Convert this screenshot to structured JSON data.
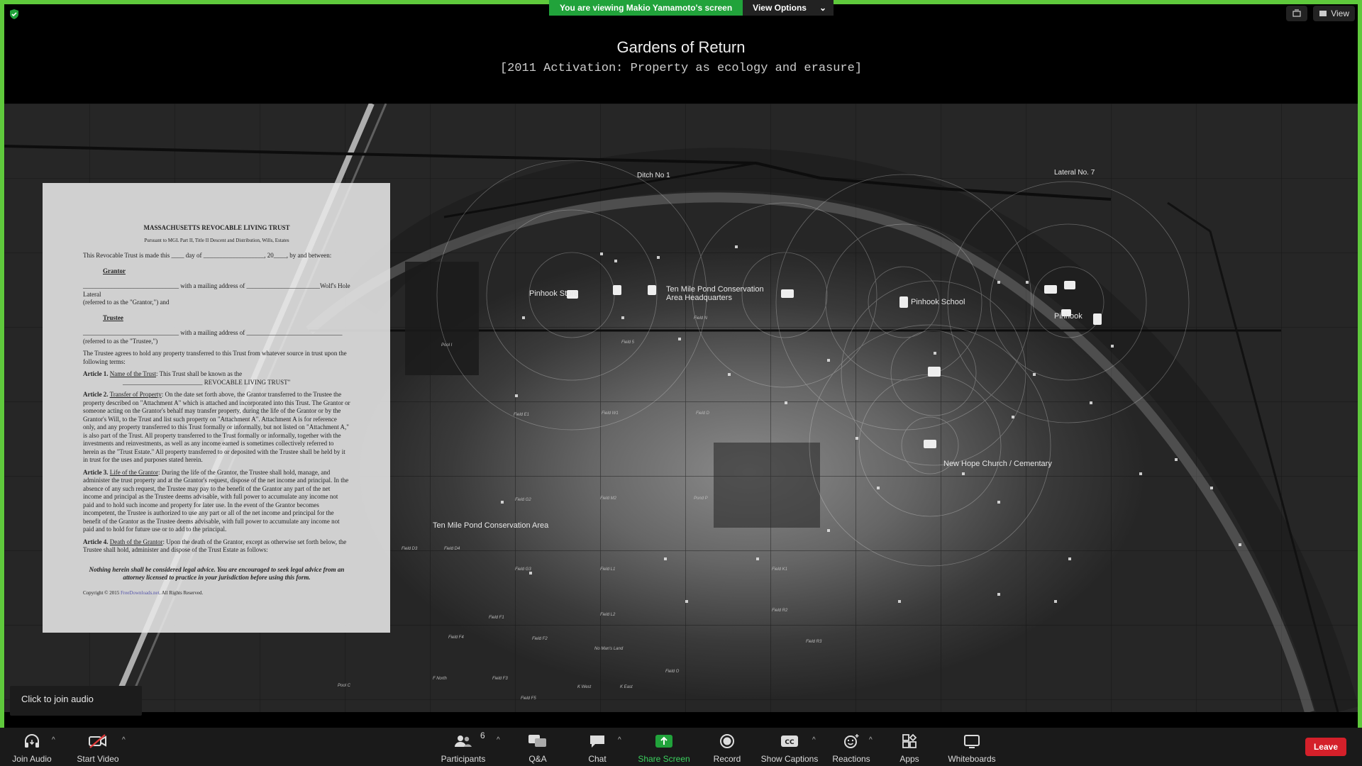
{
  "window": {
    "banner_text": "You are viewing Makio Yamamoto's screen",
    "view_options": "View Options",
    "view_button": "View"
  },
  "slide": {
    "title": "Gardens of Return",
    "subtitle": "[2011 Activation: Property as ecology and erasure]"
  },
  "map_labels": {
    "ditch": "Ditch No 1",
    "lateral": "Lateral No. 7",
    "pinhook_store": "Pinhook Store",
    "hq_line1": "Ten Mile Pond Conservation",
    "hq_line2": "Area Headquarters",
    "pinhook_school": "Pinhook School",
    "pinhook": "Pinhook",
    "church": "New Hope Church / Cementary",
    "conservation_area": "Ten Mile Pond Conservation Area"
  },
  "map_field_labels": [
    "Pool I",
    "Field 5",
    "Field N",
    "Field E1",
    "Field W1",
    "Field D",
    "Field G2",
    "Field M2",
    "Pond P",
    "Field D3",
    "Field D4",
    "Field G3",
    "Field L1",
    "Field K1",
    "Field F1",
    "Field L2",
    "Field R2",
    "Field F4",
    "Field F2",
    "No Man's Land",
    "Field R3",
    "Field O",
    "F North",
    "Field F3",
    "K West",
    "K East",
    "Pool C",
    "Field F5",
    "Pool A",
    "Pool B"
  ],
  "document": {
    "title": "MASSACHUSETTS REVOCABLE LIVING TRUST",
    "subtitle": "Pursuant to MGL Part II, Title II Descent and Distribution, Wills, Estates",
    "intro": "This Revocable Trust is made this ____ day of ___________________, 20____, by and between:",
    "grantor_heading": "Grantor",
    "grantor_line": "______________________________ with a mailing address of _______________________Wolf's Hole Lateral",
    "grantor_ref": "(referred to as the \"Grantor,\") and",
    "trustee_heading": "Trustee",
    "trustee_line": "______________________________ with a mailing address of ______________________________",
    "trustee_ref": "(referred to as the \"Trustee,\")",
    "agrees": "The Trustee agrees to hold any property transferred to this Trust from whatever source in trust upon the following terms:",
    "article1_label": "Article 1.",
    "article1_heading": "Name of the Trust",
    "article1_text": ": This Trust shall be known as the",
    "article1_name": "_________________________ REVOCABLE LIVING TRUST\"",
    "article2_label": "Article 2.",
    "article2_heading": "Transfer of Property",
    "article2_text": ": On the date set forth above, the Grantor transferred to the Trustee the property described on \"Attachment A\" which is attached and incorporated into this Trust. The Grantor or someone acting on the Grantor's behalf may transfer property, during the life of the Grantor or by the Grantor's Will, to the Trust and list such property on \"Attachment A\". Attachment A is for reference only, and any property transferred to this Trust formally or informally, but not listed on \"Attachment A,\" is also part of the Trust. All property transferred to the Trust formally or informally, together with the investments and reinvestments, as well as any income earned is sometimes collectively referred to herein as the \"Trust Estate.\" All property transferred to or deposited with the Trustee shall be held by it in trust for the uses and purposes stated herein.",
    "article3_label": "Article 3.",
    "article3_heading": "Life of the Grantor",
    "article3_text": ": During the life of the Grantor, the Trustee shall hold, manage, and administer the trust property and at the Grantor's request, dispose of the net income and principal. In the absence of any such request, the Trustee may pay to the benefit of the Grantor any part of the net income and principal as the Trustee deems advisable, with full power to accumulate any income not paid and to hold such income and property for later use. In the event of the Grantor becomes incompetent, the Trustee is authorized to use any part or all of the net income and principal for the benefit of the Grantor as the Trustee deems advisable, with full power to accumulate any income not paid and to hold for future use or to add to the principal.",
    "article4_label": "Article 4.",
    "article4_heading": "Death of the Grantor",
    "article4_text": ": Upon the death of the Grantor, except as otherwise set forth below, the Trustee shall hold, administer and dispose of the Trust Estate as follows:",
    "disclaimer": "Nothing herein shall be considered legal advice.  You are encouraged to seek legal advice from an attorney licensed to practice in your jurisdiction before using this form.",
    "copyright_pre": "Copyright © 2015 ",
    "copyright_link": "FreeDownloads.net",
    "copyright_post": ". All Rights Reserved."
  },
  "audio_tip": "Click to join audio",
  "toolbar": {
    "join_audio": "Join Audio",
    "start_video": "Start Video",
    "participants": "Participants",
    "participants_count": "6",
    "qa": "Q&A",
    "chat": "Chat",
    "share_screen": "Share Screen",
    "record": "Record",
    "captions": "Show Captions",
    "reactions": "Reactions",
    "apps": "Apps",
    "whiteboards": "Whiteboards",
    "leave": "Leave"
  },
  "colors": {
    "sharing_border": "#5fc93c",
    "banner_green": "#21a33b",
    "share_green": "#3bd05e",
    "leave_red": "#d4202a"
  }
}
